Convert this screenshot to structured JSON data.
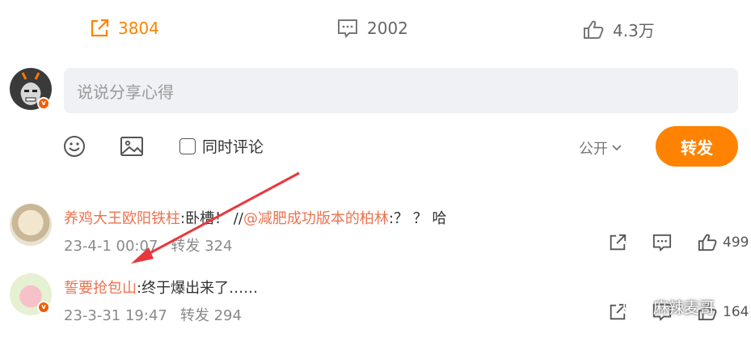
{
  "stats": {
    "forward_count": "3804",
    "comment_count": "2002",
    "like_count": "4.3万"
  },
  "composer": {
    "placeholder": "说说分享心得",
    "also_comment_label": "同时评论",
    "visibility": "公开",
    "submit_label": "转发"
  },
  "comments": [
    {
      "user": "养鸡大王欧阳铁柱",
      "separator": ":",
      "text_before": "卧槽！ //",
      "mention": "@减肥成功版本的柏林",
      "text_after": ":？ ？ 哈",
      "date": "23-4-1 00:07",
      "forward_label": "转发 324",
      "like_count": "499"
    },
    {
      "user": "誓要抢包山",
      "separator": ":",
      "text_before": "终于爆出来了……",
      "mention": "",
      "text_after": "",
      "date": "23-3-31 19:47",
      "forward_label": "转发 294",
      "like_count": "164"
    }
  ],
  "watermark": {
    "text": "麻辣麦哥"
  },
  "colors": {
    "accent": "#ff8200",
    "link": "#eb7350",
    "annotation_arrow": "#e8383d"
  },
  "icons": [
    "share-icon",
    "comment-icon",
    "like-icon",
    "emoji-icon",
    "image-icon",
    "chevron-down-icon",
    "wechat-icon"
  ]
}
